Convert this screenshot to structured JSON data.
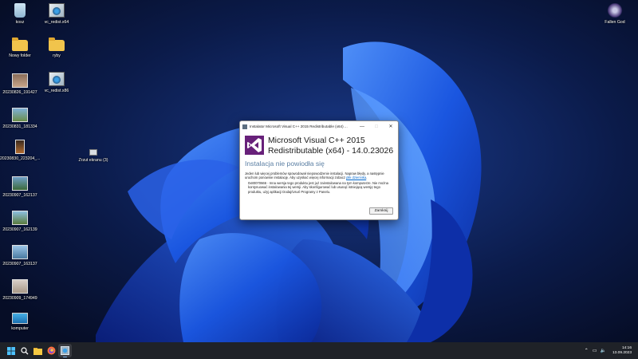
{
  "desktop": {
    "icons": [
      {
        "label": "kosz",
        "kind": "bin"
      },
      {
        "label": "vc_redist.x64",
        "kind": "exe"
      },
      {
        "label": "Nowy folder",
        "kind": "folder"
      },
      {
        "label": "ryby",
        "kind": "folder"
      },
      {
        "label": "20230826_191427",
        "kind": "photo"
      },
      {
        "label": "vc_redist.x86",
        "kind": "exe"
      },
      {
        "label": "20230831_181334",
        "kind": "photo"
      },
      {
        "label": "20230830_223204_...",
        "kind": "photo"
      },
      {
        "label": "Zrzut ekranu (3)",
        "kind": "screenshot"
      },
      {
        "label": "20230907_162137",
        "kind": "photo"
      },
      {
        "label": "20230907_162139",
        "kind": "photo"
      },
      {
        "label": "20230907_163137",
        "kind": "photo"
      },
      {
        "label": "20230909_174949",
        "kind": "photo"
      },
      {
        "label": "komputer",
        "kind": "pc"
      },
      {
        "label": "Fallen God",
        "kind": "game"
      }
    ]
  },
  "dialog": {
    "title": "Instalator Microsoft Visual C++ 2015 Redistributable (x64) ...",
    "product_line1": "Microsoft Visual C++ 2015",
    "product_line2": "Redistributable (x64) - 14.0.23026",
    "heading": "Instalacja nie powiodła się",
    "message": "Jeden lub więcej problemów spowodował niepowodzenie instalacji. Napraw błędy, a następnie uruchom ponownie instalację. Aby uzyskać więcej informacji zobacz",
    "message_link": "plik dziennika",
    "message_end": ".",
    "error": "0x80070666 - Inna wersja tego produktu jest już zainstalowana na tym komputerze. Nie można kontynuować instalowania tej wersji. Aby skonfigurować lub usunąć istniejącą wersję tego produktu, użyj aplikacji Dodaj/Usuń Programy z Panelu.",
    "close_label": "Zamknij",
    "accent": "#68217a"
  },
  "taskbar": {
    "apps": [
      "start-icon",
      "search-icon",
      "file-explorer-icon",
      "firefox-icon",
      "installer-icon"
    ],
    "time": "14:16",
    "date": "13.09.2023",
    "bg": "#1f2228"
  }
}
